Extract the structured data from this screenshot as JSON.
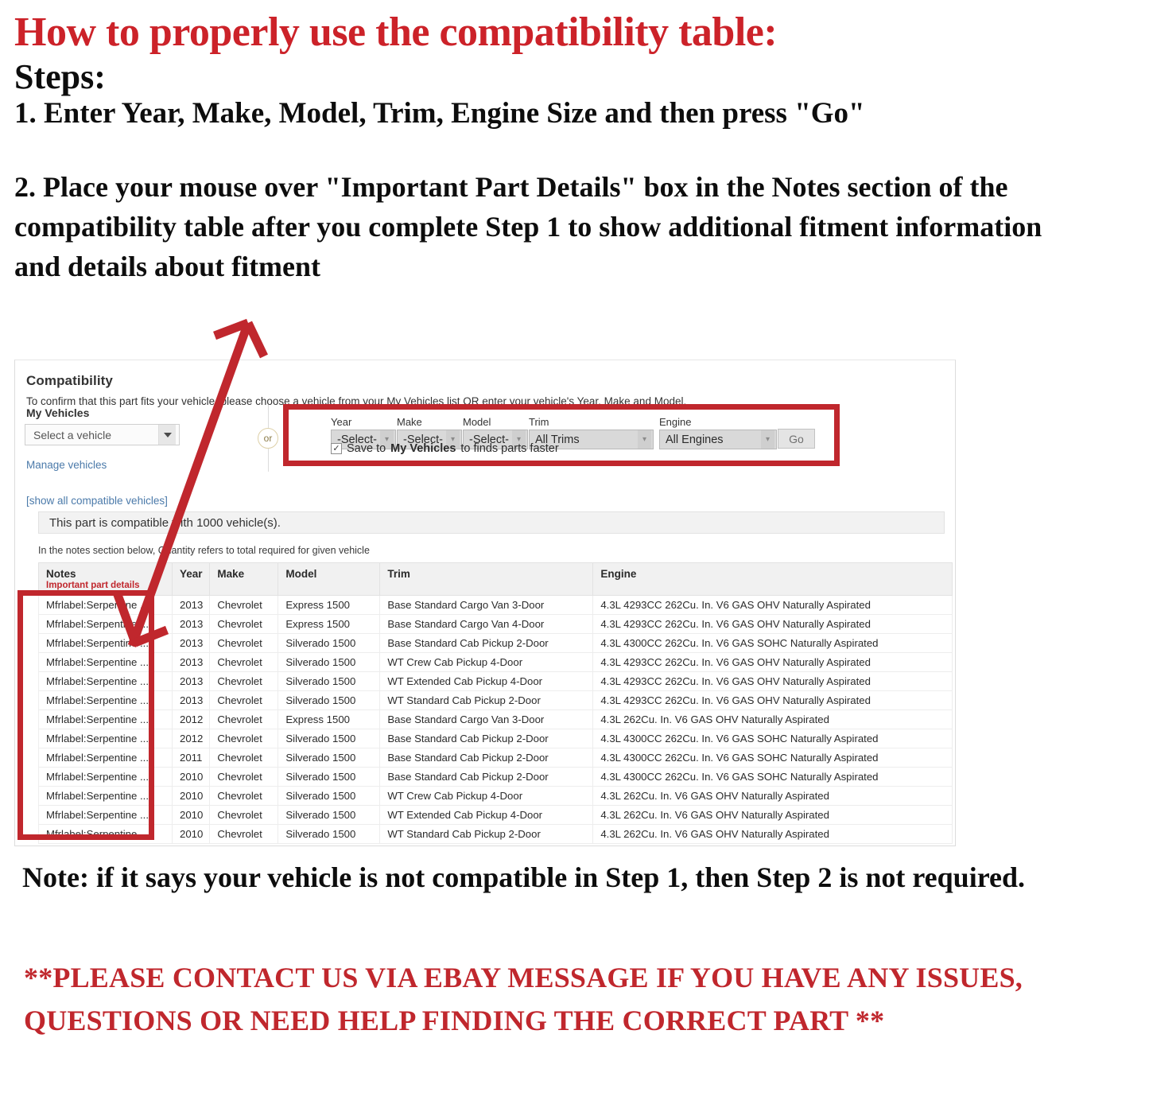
{
  "instructions": {
    "title": "How to properly use the compatibility table:",
    "steps_label": "Steps:",
    "step1": "1. Enter Year, Make, Model, Trim, Engine Size and then press \"Go\"",
    "step2": "2. Place your mouse over \"Important Part Details\" box in the Notes section of the compatibility table after you complete Step 1 to show additional fitment information and details about fitment",
    "note": "Note: if it says your vehicle is not compatible in Step 1, then Step 2 is not required.",
    "contact": "**PLEASE CONTACT US VIA EBAY MESSAGE IF YOU HAVE ANY ISSUES, QUESTIONS OR NEED HELP FINDING THE CORRECT PART **"
  },
  "compatibility": {
    "heading": "Compatibility",
    "subheading": "To confirm that this part fits your vehicle, please choose a vehicle from your My Vehicles list OR enter your vehicle's Year, Make and Model.",
    "my_vehicles_label": "My Vehicles",
    "vehicle_select_value": "Select a vehicle",
    "manage_vehicles_link": "Manage vehicles",
    "show_all_link": "[show all compatible vehicles]",
    "or_label": "or",
    "banner": "This part is compatible with 1000 vehicle(s).",
    "notes_hint": "In the notes section below, Quantity refers to total required for given vehicle",
    "form": {
      "year_label": "Year",
      "year_value": "-Select-",
      "make_label": "Make",
      "make_value": "-Select-",
      "model_label": "Model",
      "model_value": "-Select-",
      "trim_label": "Trim",
      "trim_value": "All Trims",
      "engine_label": "Engine",
      "engine_value": "All Engines",
      "go_label": "Go",
      "save_prefix": "Save to",
      "save_bold": "My Vehicles",
      "save_suffix": "to finds parts faster",
      "checkbox_glyph": "✓"
    },
    "table": {
      "columns": [
        "Notes",
        "Year",
        "Make",
        "Model",
        "Trim",
        "Engine"
      ],
      "notes_subheader": "Important part details",
      "rows": [
        {
          "notes": "Mfrlabel:Serpentine ...",
          "year": "2013",
          "make": "Chevrolet",
          "model": "Express 1500",
          "trim": "Base Standard Cargo Van 3-Door",
          "engine": "4.3L 4293CC 262Cu. In. V6 GAS OHV Naturally Aspirated"
        },
        {
          "notes": "Mfrlabel:Serpentine ...",
          "year": "2013",
          "make": "Chevrolet",
          "model": "Express 1500",
          "trim": "Base Standard Cargo Van 4-Door",
          "engine": "4.3L 4293CC 262Cu. In. V6 GAS OHV Naturally Aspirated"
        },
        {
          "notes": "Mfrlabel:Serpentine ...",
          "year": "2013",
          "make": "Chevrolet",
          "model": "Silverado 1500",
          "trim": "Base Standard Cab Pickup 2-Door",
          "engine": "4.3L 4300CC 262Cu. In. V6 GAS SOHC Naturally Aspirated"
        },
        {
          "notes": "Mfrlabel:Serpentine ...",
          "year": "2013",
          "make": "Chevrolet",
          "model": "Silverado 1500",
          "trim": "WT Crew Cab Pickup 4-Door",
          "engine": "4.3L 4293CC 262Cu. In. V6 GAS OHV Naturally Aspirated"
        },
        {
          "notes": "Mfrlabel:Serpentine ...",
          "year": "2013",
          "make": "Chevrolet",
          "model": "Silverado 1500",
          "trim": "WT Extended Cab Pickup 4-Door",
          "engine": "4.3L 4293CC 262Cu. In. V6 GAS OHV Naturally Aspirated"
        },
        {
          "notes": "Mfrlabel:Serpentine ...",
          "year": "2013",
          "make": "Chevrolet",
          "model": "Silverado 1500",
          "trim": "WT Standard Cab Pickup 2-Door",
          "engine": "4.3L 4293CC 262Cu. In. V6 GAS OHV Naturally Aspirated"
        },
        {
          "notes": "Mfrlabel:Serpentine ...",
          "year": "2012",
          "make": "Chevrolet",
          "model": "Express 1500",
          "trim": "Base Standard Cargo Van 3-Door",
          "engine": "4.3L 262Cu. In. V6 GAS OHV Naturally Aspirated"
        },
        {
          "notes": "Mfrlabel:Serpentine ...",
          "year": "2012",
          "make": "Chevrolet",
          "model": "Silverado 1500",
          "trim": "Base Standard Cab Pickup 2-Door",
          "engine": "4.3L 4300CC 262Cu. In. V6 GAS SOHC Naturally Aspirated"
        },
        {
          "notes": "Mfrlabel:Serpentine ...",
          "year": "2011",
          "make": "Chevrolet",
          "model": "Silverado 1500",
          "trim": "Base Standard Cab Pickup 2-Door",
          "engine": "4.3L 4300CC 262Cu. In. V6 GAS SOHC Naturally Aspirated"
        },
        {
          "notes": "Mfrlabel:Serpentine ...",
          "year": "2010",
          "make": "Chevrolet",
          "model": "Silverado 1500",
          "trim": "Base Standard Cab Pickup 2-Door",
          "engine": "4.3L 4300CC 262Cu. In. V6 GAS SOHC Naturally Aspirated"
        },
        {
          "notes": "Mfrlabel:Serpentine ...",
          "year": "2010",
          "make": "Chevrolet",
          "model": "Silverado 1500",
          "trim": "WT Crew Cab Pickup 4-Door",
          "engine": "4.3L 262Cu. In. V6 GAS OHV Naturally Aspirated"
        },
        {
          "notes": "Mfrlabel:Serpentine ...",
          "year": "2010",
          "make": "Chevrolet",
          "model": "Silverado 1500",
          "trim": "WT Extended Cab Pickup 4-Door",
          "engine": "4.3L 262Cu. In. V6 GAS OHV Naturally Aspirated"
        },
        {
          "notes": "Mfrlabel:Serpentine ...",
          "year": "2010",
          "make": "Chevrolet",
          "model": "Silverado 1500",
          "trim": "WT Standard Cab Pickup 2-Door",
          "engine": "4.3L 262Cu. In. V6 GAS OHV Naturally Aspirated"
        }
      ]
    }
  },
  "colors": {
    "brand_red": "#c0272d",
    "title_red": "#cc2229",
    "link_blue": "#4b7aaa",
    "text_dark": "#0d0d0d"
  }
}
